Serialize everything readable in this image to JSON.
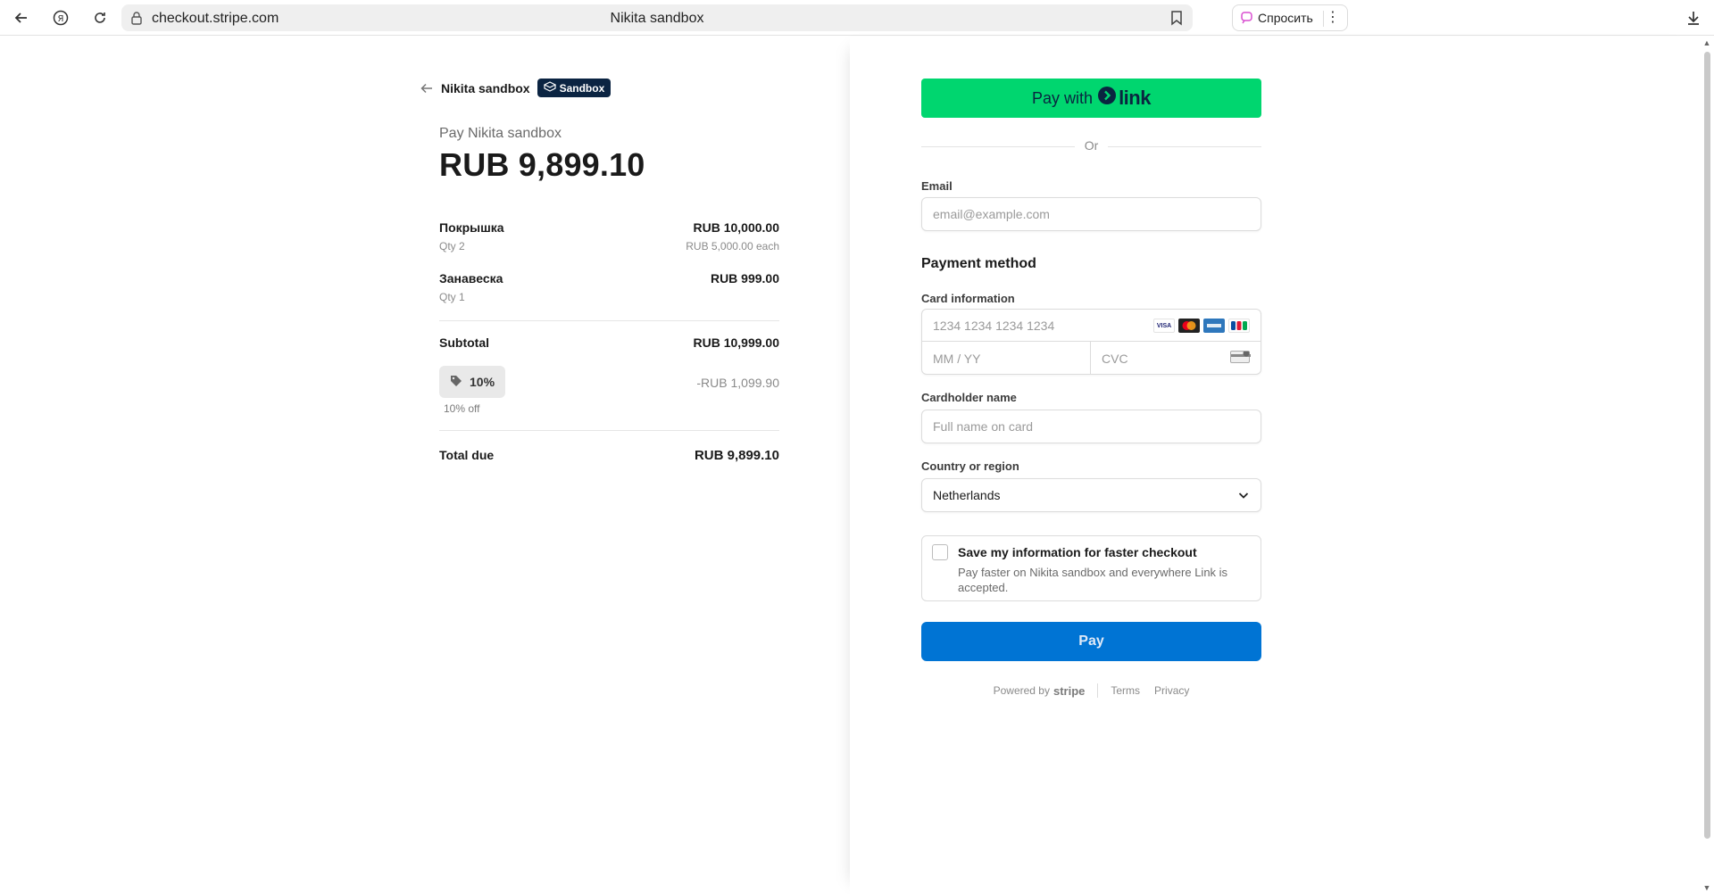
{
  "browser": {
    "url": "checkout.stripe.com",
    "tab_title": "Nikita sandbox",
    "ask_label": "Спросить"
  },
  "summary": {
    "merchant": "Nikita sandbox",
    "badge": "Sandbox",
    "pay_label": "Pay Nikita sandbox",
    "amount": "RUB 9,899.10",
    "items": [
      {
        "name": "Покрышка",
        "qty": "Qty 2",
        "price": "RUB 10,000.00",
        "each": "RUB 5,000.00 each"
      },
      {
        "name": "Занавеска",
        "qty": "Qty 1",
        "price": "RUB 999.00",
        "each": ""
      }
    ],
    "subtotal_label": "Subtotal",
    "subtotal_value": "RUB 10,999.00",
    "promo_code": "10%",
    "promo_desc": "10% off",
    "promo_value": "-RUB 1,099.90",
    "total_label": "Total due",
    "total_value": "RUB 9,899.10"
  },
  "form": {
    "link_pay_prefix": "Pay with",
    "link_logo": "link",
    "or": "Or",
    "email_label": "Email",
    "email_placeholder": "email@example.com",
    "payment_method": "Payment method",
    "card_label": "Card information",
    "card_placeholder": "1234 1234 1234 1234",
    "expiry_placeholder": "MM / YY",
    "cvc_placeholder": "CVC",
    "cardholder_label": "Cardholder name",
    "cardholder_placeholder": "Full name on card",
    "country_label": "Country or region",
    "country_value": "Netherlands",
    "save_title": "Save my information for faster checkout",
    "save_desc": "Pay faster on Nikita sandbox and everywhere Link is accepted.",
    "pay_button": "Pay",
    "powered_by": "Powered by",
    "stripe": "stripe",
    "terms": "Terms",
    "privacy": "Privacy",
    "card_brands": [
      "VISA",
      "mastercard",
      "amex",
      "JCB"
    ]
  },
  "colors": {
    "link_green": "#00d66f",
    "pay_blue": "#0074d4",
    "sandbox_navy": "#0b2442"
  },
  "icons": [
    "back-icon",
    "yandex-icon",
    "reload-icon",
    "lock-icon",
    "bookmark-icon",
    "alice-icon",
    "menu-dots-icon",
    "download-icon",
    "arrow-left-icon",
    "sandbox-box-icon",
    "link-chevron-icon",
    "tag-icon",
    "chevron-down-icon",
    "cvc-card-icon"
  ]
}
